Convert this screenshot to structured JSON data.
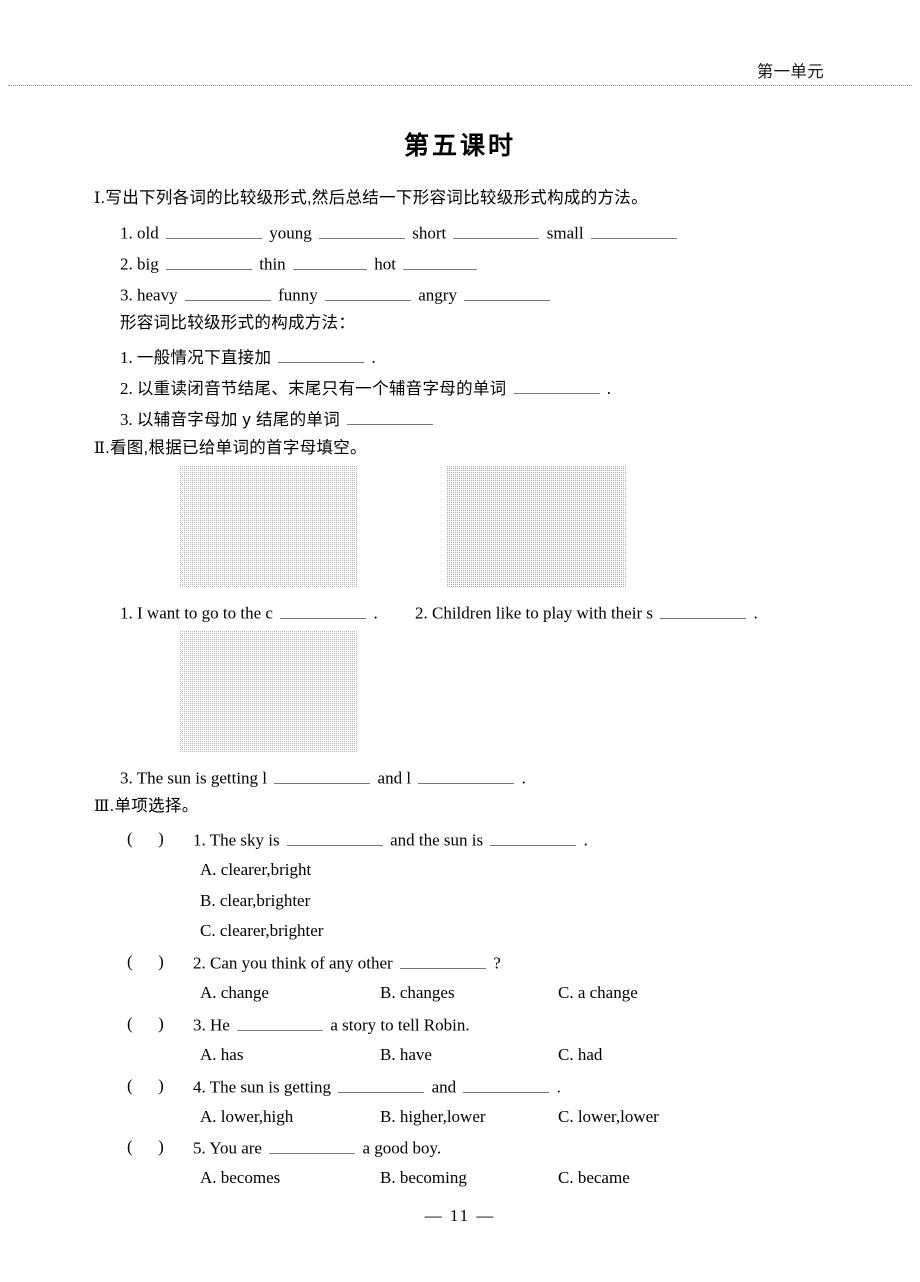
{
  "header": {
    "unit_label": "第一单元"
  },
  "title": "第五课时",
  "sections": {
    "one": {
      "marker": "Ⅰ",
      "heading": ".写出下列各词的比较级形式,然后总结一下形容词比较级形式构成的方法。",
      "rows": [
        {
          "num": "1.",
          "words": [
            "old",
            "young",
            "short",
            "small"
          ]
        },
        {
          "num": "2.",
          "words": [
            "big",
            "thin",
            "hot"
          ]
        },
        {
          "num": "3.",
          "words": [
            "heavy",
            "funny",
            "angry"
          ]
        }
      ],
      "rules_intro": "形容词比较级形式的构成方法：",
      "rules": [
        {
          "num": "1.",
          "text": "一般情况下直接加",
          "tail": "."
        },
        {
          "num": "2.",
          "text": "以重读闭音节结尾、末尾只有一个辅音字母的单词",
          "tail": "."
        },
        {
          "num": "3.",
          "text": "以辅音字母加 y 结尾的单词",
          "tail": ""
        }
      ]
    },
    "two": {
      "marker": "Ⅱ",
      "heading": ".看图,根据已给单词的首字母填空。",
      "items": [
        {
          "num": "1.",
          "pre": "I want to go to the c",
          "post": ".",
          "image_name": "countryside-photo",
          "image_alt": "countryside village with houses and field"
        },
        {
          "num": "2.",
          "pre": "Children like to play with their s",
          "post": ".",
          "image_name": "shadows-photo",
          "image_alt": "shadows of four people on the ground"
        },
        {
          "num": "3.",
          "pre": "The sun is getting l",
          "mid": "and l",
          "post": ".",
          "image_name": "sunset-photo",
          "image_alt": "sunset sky with clouds over dark hill"
        }
      ]
    },
    "three": {
      "marker": "Ⅲ",
      "heading": ".单项选择。",
      "questions": [
        {
          "num": "1.",
          "stem_pre": "The sky is",
          "stem_mid": "and the sun is",
          "stem_post": ".",
          "layout": "stacked",
          "options": [
            "A. clearer,bright",
            "B. clear,brighter",
            "C. clearer,brighter"
          ]
        },
        {
          "num": "2.",
          "stem_pre": "Can you think of any other",
          "stem_post": "?",
          "layout": "inline",
          "options": [
            "A. change",
            "B. changes",
            "C. a change"
          ]
        },
        {
          "num": "3.",
          "stem_pre": "He",
          "stem_post": "a story to tell Robin.",
          "layout": "inline",
          "options": [
            "A. has",
            "B. have",
            "C. had"
          ]
        },
        {
          "num": "4.",
          "stem_pre": "The sun is getting",
          "stem_mid": "and",
          "stem_post": ".",
          "layout": "inline",
          "options": [
            "A. lower,high",
            "B. higher,lower",
            "C. lower,lower"
          ]
        },
        {
          "num": "5.",
          "stem_pre": "You are",
          "stem_post": "a good boy.",
          "layout": "inline",
          "options": [
            "A. becomes",
            "B. becoming",
            "C. became"
          ]
        }
      ]
    }
  },
  "footer": {
    "page_number": "— 11 —"
  }
}
